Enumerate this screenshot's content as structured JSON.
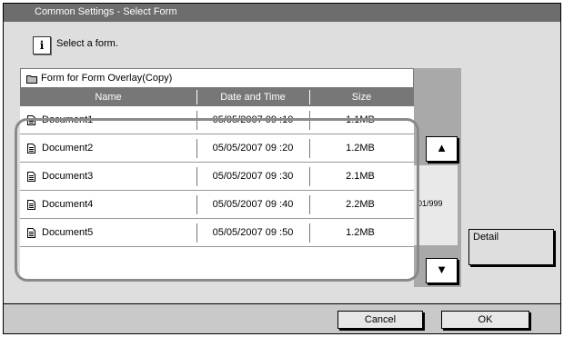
{
  "window": {
    "title": "Common Settings - Select Form"
  },
  "message": {
    "text": "Select a form."
  },
  "list": {
    "folder_name": "Form for Form Overlay(Copy)",
    "columns": [
      "Name",
      "Date and Time",
      "Size"
    ],
    "rows": [
      {
        "name": "Document1",
        "datetime": "05/05/2007 09 :10",
        "size": "1.1MB"
      },
      {
        "name": "Document2",
        "datetime": "05/05/2007 09 :20",
        "size": "1.2MB"
      },
      {
        "name": "Document3",
        "datetime": "05/05/2007 09 :30",
        "size": "2.1MB"
      },
      {
        "name": "Document4",
        "datetime": "05/05/2007 09 :40",
        "size": "2.2MB"
      },
      {
        "name": "Document5",
        "datetime": "05/05/2007 09 :50",
        "size": "1.2MB"
      }
    ]
  },
  "pager": {
    "page_text": "01/999",
    "up_icon": "▲",
    "down_icon": "▼"
  },
  "buttons": {
    "detail": "Detail",
    "cancel": "Cancel",
    "ok": "OK"
  }
}
